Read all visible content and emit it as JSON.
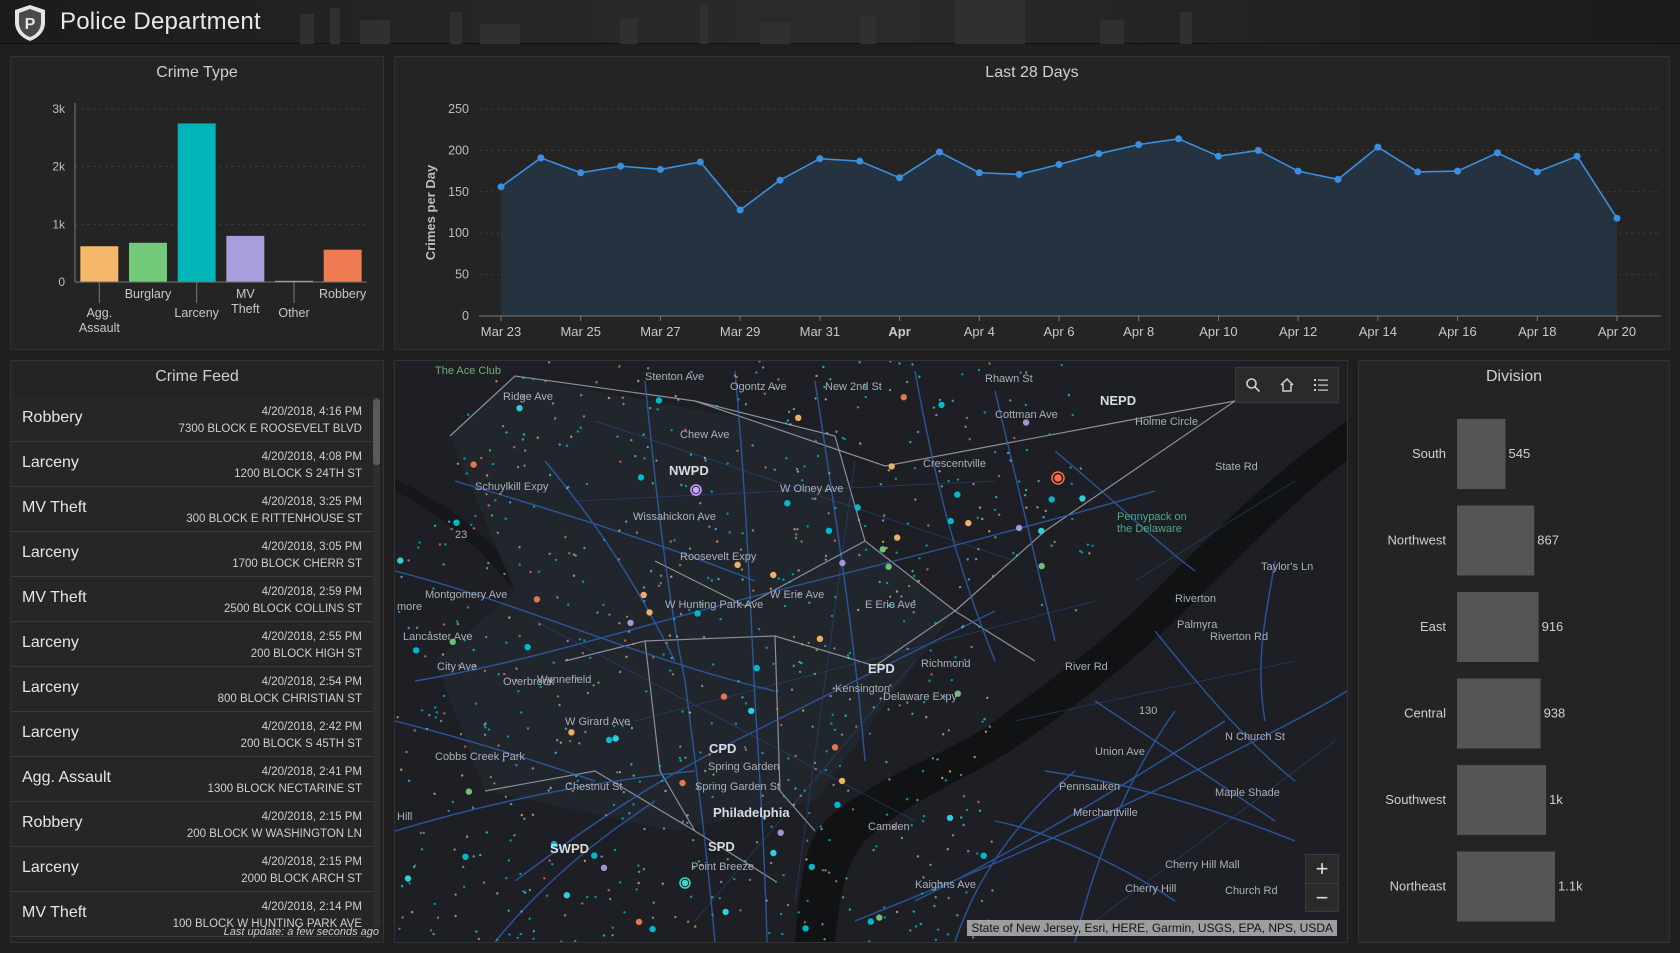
{
  "header": {
    "title": "Police Department",
    "badge_letter": "P"
  },
  "crime_type": {
    "title": "Crime Type",
    "chart_data": {
      "type": "bar",
      "categories": [
        "Agg. Assault",
        "Burglary",
        "Larceny",
        "MV Theft",
        "Other",
        "Robbery"
      ],
      "values": [
        620,
        680,
        2750,
        800,
        20,
        560
      ],
      "colors": [
        "#f5b86a",
        "#72c97a",
        "#00b5b8",
        "#a99ddc",
        "#e9c46a",
        "#ee7b52"
      ],
      "yticks": [
        "0",
        "1k",
        "2k",
        "3k"
      ],
      "ylim": [
        0,
        3000
      ]
    }
  },
  "last_28": {
    "title": "Last 28 Days",
    "chart_data": {
      "type": "area",
      "ylabel": "Crimes per Day",
      "ylim": [
        0,
        250
      ],
      "yticks": [
        0,
        50,
        100,
        150,
        200,
        250
      ],
      "xtick_labels": [
        "Mar 23",
        "Mar 25",
        "Mar 27",
        "Mar 29",
        "Mar 31",
        "Apr",
        "Apr 4",
        "Apr 6",
        "Apr 8",
        "Apr 10",
        "Apr 12",
        "Apr 14",
        "Apr 16",
        "Apr 18",
        "Apr 20"
      ],
      "values": [
        156,
        191,
        173,
        181,
        177,
        186,
        128,
        164,
        190,
        187,
        167,
        198,
        173,
        171,
        183,
        196,
        207,
        214,
        193,
        200,
        175,
        165,
        204,
        174,
        175,
        197,
        174,
        193,
        118
      ],
      "line_color": "#3a8fe0"
    }
  },
  "crime_feed": {
    "title": "Crime Feed",
    "items": [
      {
        "type": "Robbery",
        "time": "4/20/2018, 4:16 PM",
        "address": "7300 BLOCK E ROOSEVELT BLVD"
      },
      {
        "type": "Larceny",
        "time": "4/20/2018, 4:08 PM",
        "address": "1200 BLOCK S 24TH ST"
      },
      {
        "type": "MV Theft",
        "time": "4/20/2018, 3:25 PM",
        "address": "300 BLOCK E RITTENHOUSE ST"
      },
      {
        "type": "Larceny",
        "time": "4/20/2018, 3:05 PM",
        "address": "1700 BLOCK CHERR ST"
      },
      {
        "type": "MV Theft",
        "time": "4/20/2018, 2:59 PM",
        "address": "2500 BLOCK COLLINS ST"
      },
      {
        "type": "Larceny",
        "time": "4/20/2018, 2:55 PM",
        "address": "200 BLOCK HIGH ST"
      },
      {
        "type": "Larceny",
        "time": "4/20/2018, 2:54 PM",
        "address": "800 BLOCK CHRISTIAN ST"
      },
      {
        "type": "Larceny",
        "time": "4/20/2018, 2:42 PM",
        "address": "200 BLOCK S 45TH ST"
      },
      {
        "type": "Agg. Assault",
        "time": "4/20/2018, 2:41 PM",
        "address": "1300 BLOCK NECTARINE ST"
      },
      {
        "type": "Robbery",
        "time": "4/20/2018, 2:15 PM",
        "address": "200 BLOCK W WASHINGTON LN"
      },
      {
        "type": "Larceny",
        "time": "4/20/2018, 2:15 PM",
        "address": "2000 BLOCK ARCH ST"
      },
      {
        "type": "MV Theft",
        "time": "4/20/2018, 2:14 PM",
        "address": "100 BLOCK W HUNTING PARK AVE"
      }
    ],
    "last_update": "Last update: a few seconds ago"
  },
  "map": {
    "attribution": "State of New Jersey, Esri, HERE, Garmin, USGS, EPA, NPS, USDA",
    "zoom_in": "+",
    "zoom_out": "−",
    "labels": [
      "The Ace Club",
      "Ridge Ave",
      "Stenton Ave",
      "Ogontz Ave",
      "Rhawn St",
      "New 2nd St",
      "NEPD",
      "Holme Circle",
      "NWPD",
      "Crescentville",
      "Cottman Ave",
      "Chew Ave",
      "W Olney Ave",
      "Schuylkill Expy",
      "Wissahickon Ave",
      "Roosevelt Expy",
      "Montgomery Ave",
      "W Hunting Park Ave",
      "W Erie Ave",
      "E Erie Ave",
      "Lancaster Ave",
      "Overbrook",
      "Wynnefield",
      "City Ave",
      "EPD",
      "Richmond",
      "Kensington",
      "Delaware Expy",
      "Riverton",
      "Palmyra",
      "Taylor's Ln",
      "Riverton Rd",
      "River Rd",
      "W Girard Ave",
      "Cobbs Creek Park",
      "CPD",
      "Spring Garden",
      "Spring Garden St",
      "Chestnut St",
      "Philadelphia",
      "Pennsauken",
      "Maple Shade",
      "Merchantville",
      "SWPD",
      "SPD",
      "Point Breeze",
      "Camden",
      "Kaighns Ave",
      "Cherry Hill",
      "Cherry Hill Mall",
      "Church Rd",
      "N Church St",
      "Union Ave",
      "Pennypack on the Delaware",
      "State Rd",
      "23",
      "130",
      "Hill",
      "more"
    ],
    "tools": [
      "search-icon",
      "home-icon",
      "list-icon"
    ]
  },
  "division": {
    "title": "Division",
    "chart_data": {
      "type": "bar",
      "orientation": "horizontal",
      "categories": [
        "South",
        "Northwest",
        "East",
        "Central",
        "Southwest",
        "Northeast"
      ],
      "values": [
        545,
        867,
        916,
        938,
        1000,
        1100
      ],
      "value_labels": [
        "545",
        "867",
        "916",
        "938",
        "1k",
        "1.1k"
      ],
      "bar_color": "#555555"
    }
  }
}
